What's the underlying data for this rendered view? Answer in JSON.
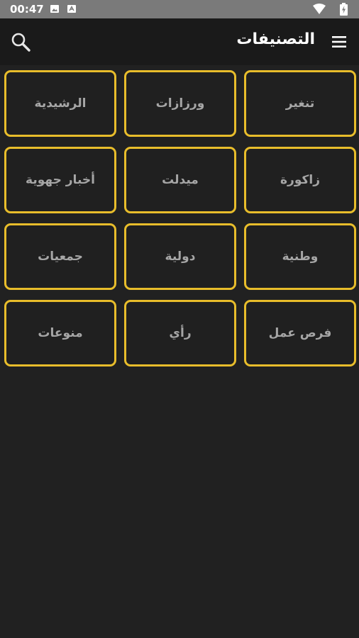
{
  "status_bar": {
    "time": "00:47",
    "icons": [
      "image-notification-icon",
      "store-notification-icon",
      "wifi-icon",
      "battery-icon"
    ]
  },
  "app_bar": {
    "title": "التصنيفات",
    "search_icon": "search-icon",
    "menu_icon": "hamburger-menu-icon"
  },
  "categories": [
    {
      "label": "تنغير"
    },
    {
      "label": "ورزازات"
    },
    {
      "label": "الرشيدية"
    },
    {
      "label": "زاكورة"
    },
    {
      "label": "ميدلت"
    },
    {
      "label": "أخبار جهوية"
    },
    {
      "label": "وطنية"
    },
    {
      "label": "دولية"
    },
    {
      "label": "جمعيات"
    },
    {
      "label": "فرص عمل"
    },
    {
      "label": "رأي"
    },
    {
      "label": "منوعات"
    }
  ],
  "colors": {
    "background": "#212121",
    "app_bar": "#1a1a1a",
    "status_bar": "#7a7a7a",
    "accent_border": "#e8bd2b",
    "tile_text": "#a6a6a6"
  }
}
